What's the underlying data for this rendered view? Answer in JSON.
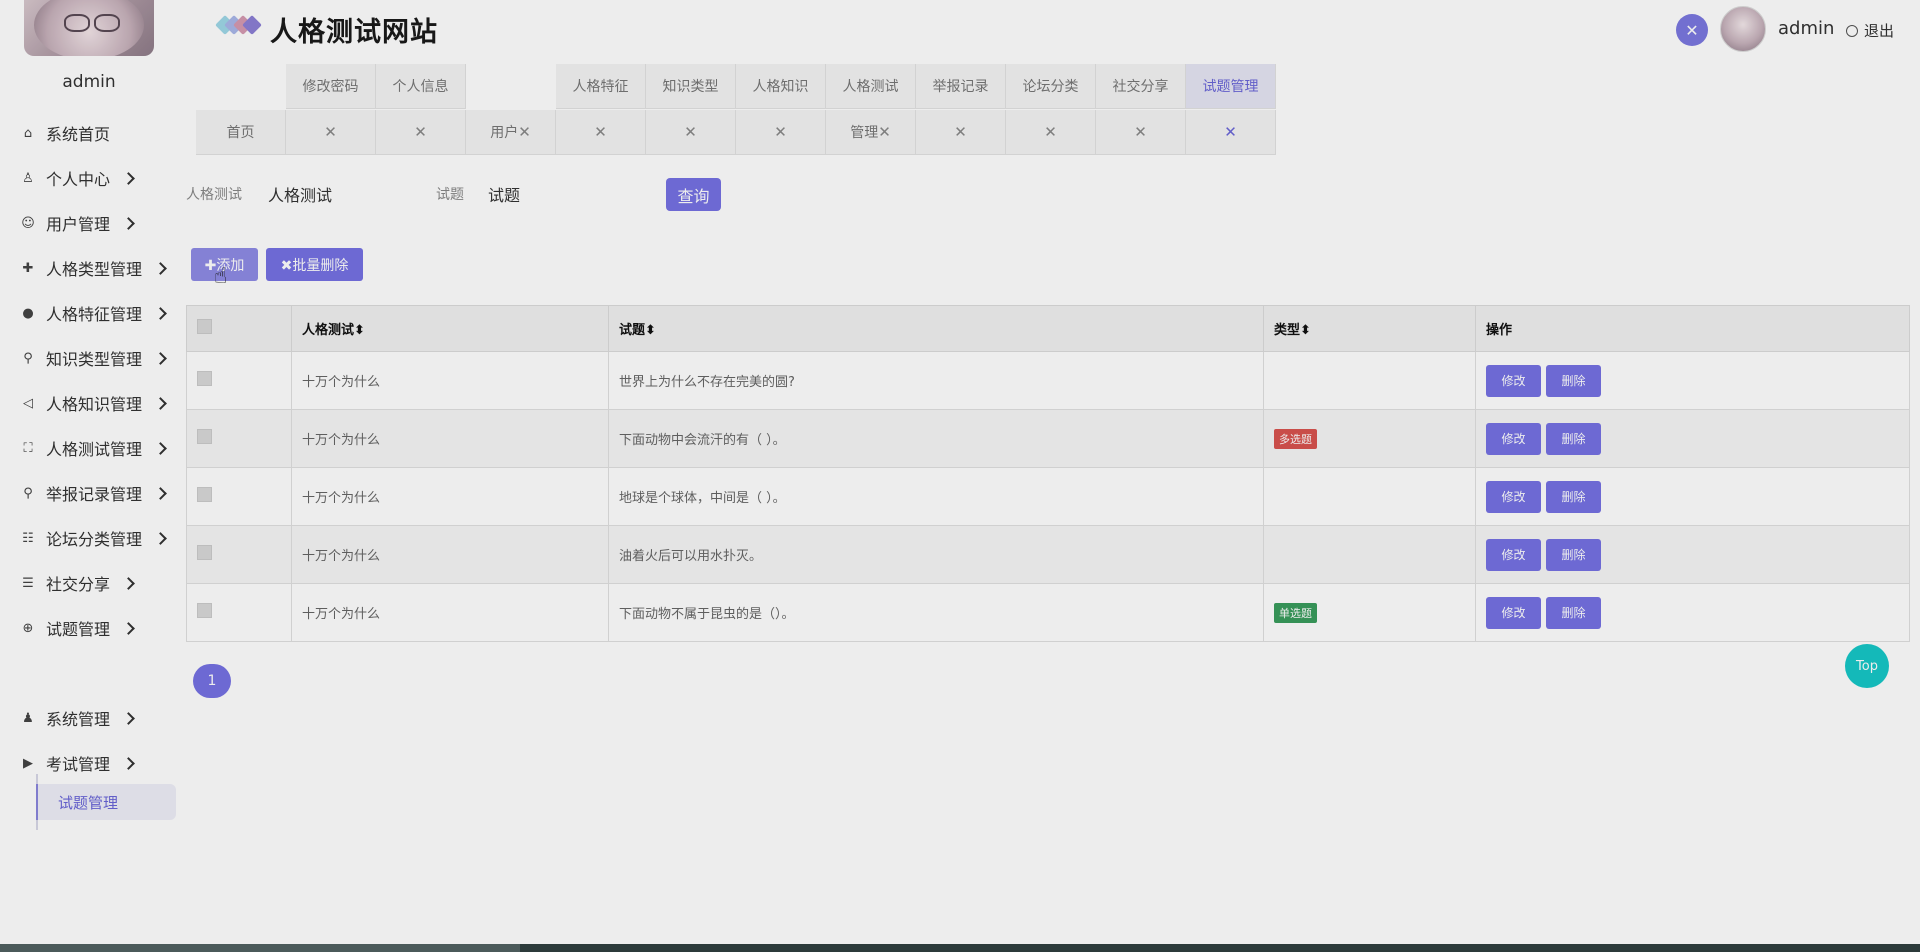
{
  "sidebar": {
    "admin_name": "admin",
    "menu": [
      {
        "label": "系统首页",
        "icon": "home-icon",
        "glyph": "⌂",
        "chevron": false
      },
      {
        "label": "个人中心",
        "icon": "user-icon",
        "glyph": "♙",
        "chevron": true
      },
      {
        "label": "用户管理",
        "icon": "smile-icon",
        "glyph": "☺",
        "chevron": true
      },
      {
        "label": "人格类型管理",
        "icon": "plus-icon",
        "glyph": "✚",
        "chevron": true
      },
      {
        "label": "人格特征管理",
        "icon": "person-icon",
        "glyph": "●",
        "chevron": true
      },
      {
        "label": "知识类型管理",
        "icon": "key-icon",
        "glyph": "⚲",
        "chevron": true
      },
      {
        "label": "人格知识管理",
        "icon": "sound-icon",
        "glyph": "◁",
        "chevron": true
      },
      {
        "label": "人格测试管理",
        "icon": "scan-icon",
        "glyph": "⛶",
        "chevron": true
      },
      {
        "label": "举报记录管理",
        "icon": "search-icon",
        "glyph": "⚲",
        "chevron": true
      },
      {
        "label": "论坛分类管理",
        "icon": "list-icon",
        "glyph": "☷",
        "chevron": true
      },
      {
        "label": "社交分享",
        "icon": "menu-icon",
        "glyph": "☰",
        "chevron": true
      },
      {
        "label": "试题管理",
        "icon": "zoom-icon",
        "glyph": "⊕",
        "chevron": true
      },
      {
        "label": "系统管理",
        "icon": "users-icon",
        "glyph": "♟",
        "chevron": true
      },
      {
        "label": "考试管理",
        "icon": "play-icon",
        "glyph": "▶",
        "chevron": true
      }
    ],
    "submenu_label": "试题管理"
  },
  "header": {
    "title": "人格测试网站",
    "username": "admin",
    "logout": "退出"
  },
  "tabs": {
    "top": [
      "修改密码",
      "个人信息",
      "人格特征",
      "知识类型",
      "人格知识",
      "人格测试",
      "举报记录",
      "论坛分类",
      "社交分享",
      "试题管理"
    ],
    "bottom": [
      "首页",
      "用户",
      "管理"
    ]
  },
  "search": {
    "label1": "人格测试",
    "value1": "人格测试",
    "label2": "试题",
    "value2": "试题",
    "button": "查询"
  },
  "actions": {
    "add": "✚添加",
    "batch_delete": "✖批量删除"
  },
  "table": {
    "headers": [
      "人格测试",
      "试题",
      "类型",
      "操作"
    ],
    "sort_glyph": "⬍",
    "rows": [
      {
        "test": "十万个为什么",
        "question": "世界上为什么不存在完美的圆?",
        "type": "",
        "type_color": ""
      },
      {
        "test": "十万个为什么",
        "question": "下面动物中会流汗的有（ ）。",
        "type": "多选题",
        "type_color": "#d9534f"
      },
      {
        "test": "十万个为什么",
        "question": "地球是个球体，中间是（ ）。",
        "type": "",
        "type_color": ""
      },
      {
        "test": "十万个为什么",
        "question": "油着火后可以用水扑灭。",
        "type": "",
        "type_color": ""
      },
      {
        "test": "十万个为什么",
        "question": "下面动物不属于昆虫的是（）。",
        "type": "单选题",
        "type_color": "#3a9d5d"
      }
    ],
    "edit_label": "修改",
    "delete_label": "删除"
  },
  "pagination": {
    "current": "1"
  },
  "top_button": "Top",
  "colors": {
    "accent": "#7672e4",
    "top": "#16c7c7"
  }
}
